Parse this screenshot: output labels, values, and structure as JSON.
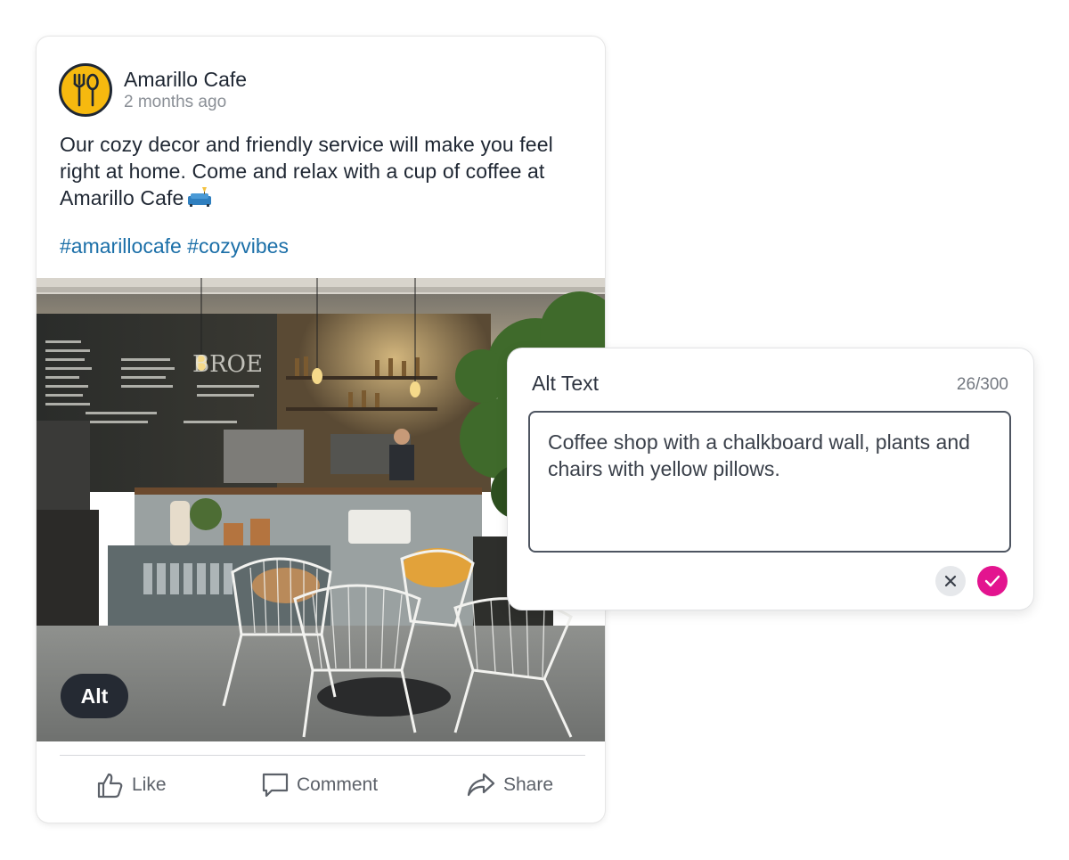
{
  "post": {
    "author": "Amarillo Cafe",
    "time_ago": "2 months ago",
    "avatar_icon": "fork-spoon-icon",
    "body": "Our cozy decor and friendly service will make you feel right at home. Come and relax with a cup of coffee at Amarillo Cafe",
    "body_emoji": "couch-and-lamp",
    "hashtags": "#amarillocafe #cozyvibes",
    "image_alt_badge": "Alt",
    "actions": [
      {
        "label": "Like",
        "icon": "thumbs-up-icon"
      },
      {
        "label": "Comment",
        "icon": "comment-icon"
      },
      {
        "label": "Share",
        "icon": "share-icon"
      }
    ]
  },
  "alt_editor": {
    "title": "Alt Text",
    "counter": "26/300",
    "value": "Coffee shop with a chalkboard wall, plants and chairs with yellow pillows.",
    "cancel_icon": "close-icon",
    "confirm_icon": "check-icon"
  },
  "colors": {
    "avatar_bg": "#f6b90f",
    "hashtag": "#1b6fa8",
    "confirm_accent": "#e3148f",
    "badge_bg": "#252a33"
  }
}
